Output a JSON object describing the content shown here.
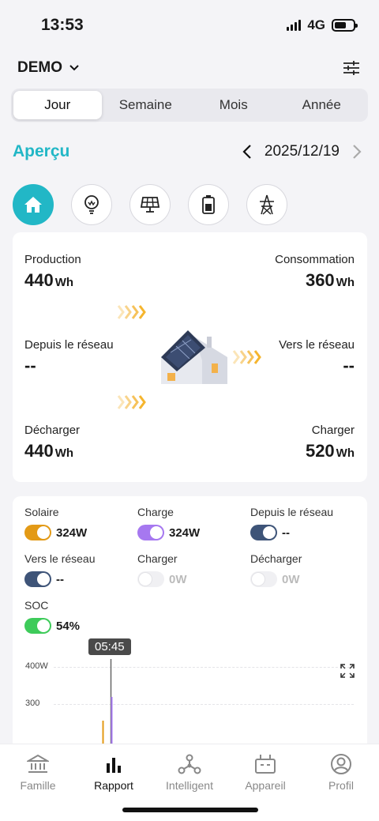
{
  "status_bar": {
    "time": "13:53",
    "network": "4G"
  },
  "header": {
    "site_name": "DEMO"
  },
  "period_tabs": [
    {
      "label": "Jour",
      "active": true
    },
    {
      "label": "Semaine",
      "active": false
    },
    {
      "label": "Mois",
      "active": false
    },
    {
      "label": "Année",
      "active": false
    }
  ],
  "overview": {
    "title": "Aperçu",
    "date": "2025/12/19"
  },
  "categories": [
    "home-icon",
    "bulb-icon",
    "solar-panel-icon",
    "battery-icon",
    "grid-tower-icon"
  ],
  "flow": {
    "production": {
      "label": "Production",
      "value": "440",
      "unit": "Wh"
    },
    "consumption": {
      "label": "Consommation",
      "value": "360",
      "unit": "Wh"
    },
    "from_grid": {
      "label": "Depuis le réseau",
      "value": "--"
    },
    "to_grid": {
      "label": "Vers le réseau",
      "value": "--"
    },
    "discharge": {
      "label": "Décharger",
      "value": "440",
      "unit": "Wh"
    },
    "charge": {
      "label": "Charger",
      "value": "520",
      "unit": "Wh"
    }
  },
  "legend": [
    {
      "name": "Solaire",
      "value": "324W",
      "on": true,
      "color": "#e39a16"
    },
    {
      "name": "Charge",
      "value": "324W",
      "on": true,
      "color": "#a678f0"
    },
    {
      "name": "Depuis le réseau",
      "value": "--",
      "on": true,
      "color": "#3e5478"
    },
    {
      "name": "Vers le réseau",
      "value": "--",
      "on": true,
      "color": "#3e5478"
    },
    {
      "name": "Charger",
      "value": "0W",
      "on": false,
      "color": "#f0f0f3"
    },
    {
      "name": "Décharger",
      "value": "0W",
      "on": false,
      "color": "#f0f0f3"
    },
    {
      "name": "SOC",
      "value": "54%",
      "on": true,
      "color": "#3ecb5a"
    }
  ],
  "chart": {
    "tooltip_time": "05:45",
    "y_ticks": [
      "400W",
      "300"
    ]
  },
  "chart_data": {
    "type": "line",
    "series": [
      {
        "name": "Solaire",
        "color": "#e39a16"
      },
      {
        "name": "Charge",
        "color": "#a678f0"
      }
    ],
    "ylabel": "",
    "y_ticks": [
      400,
      300
    ],
    "highlight_x": "05:45"
  },
  "tabs": [
    {
      "label": "Famille",
      "active": false
    },
    {
      "label": "Rapport",
      "active": true
    },
    {
      "label": "Intelligent",
      "active": false
    },
    {
      "label": "Appareil",
      "active": false
    },
    {
      "label": "Profil",
      "active": false
    }
  ],
  "colors": {
    "accent": "#22b7c6",
    "chevron": "#f5b52e"
  }
}
